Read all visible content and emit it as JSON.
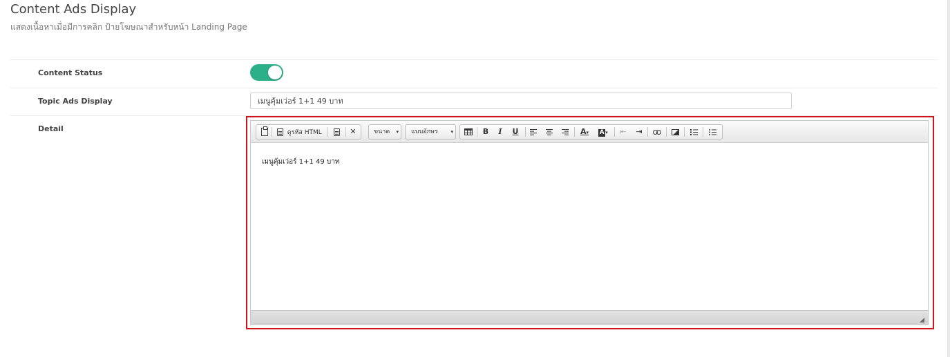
{
  "page": {
    "title": "Content Ads Display",
    "subtitle": "แสดงเนื้อหาเมื่อมีการคลิก ป้ายโฆษณาสำหรับหน้า Landing Page"
  },
  "form": {
    "content_status": {
      "label": "Content Status",
      "enabled": true,
      "accent_color": "#2bb089"
    },
    "topic": {
      "label": "Topic Ads Display",
      "value": "เมนูคุ้มเว่อร์ 1+1 49 บาท"
    },
    "detail": {
      "label": "Detail",
      "highlight_color": "#d0131b",
      "toolbar": {
        "view_source_label": "ดูรหัส HTML",
        "size_label": "ขนาด",
        "font_label": "แบบอักษร",
        "bold": "B",
        "italic": "I",
        "underline": "U",
        "text_color": "A",
        "bg_color": "A",
        "caret": "▾"
      },
      "content": "เมนูคุ้มเว่อร์ 1+1 49 บาท"
    }
  }
}
